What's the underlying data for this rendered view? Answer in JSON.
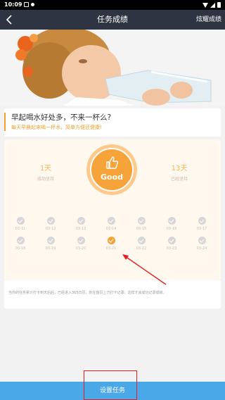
{
  "status_bar": {
    "time": "10:09"
  },
  "nav": {
    "back_icon": "chevron-left-icon",
    "title": "任务成绩",
    "share": "炫耀成绩"
  },
  "task": {
    "title": "早起喝水好处多，不来一杯么?",
    "subtitle": "每天早晨起来喝一杯水，简单方便还健康!"
  },
  "progress": {
    "completed_days": "1天",
    "completed_label": "成功坚持",
    "participants": "13天",
    "participants_label": "已经坚持",
    "badge": "Good",
    "days": [
      {
        "date": "03-11",
        "done": false
      },
      {
        "date": "03-12",
        "done": false
      },
      {
        "date": "03-13",
        "done": false
      },
      {
        "date": "03-14",
        "done": false
      },
      {
        "date": "03-15",
        "done": false
      },
      {
        "date": "03-16",
        "done": false
      },
      {
        "date": "03-17",
        "done": false
      },
      {
        "date": "03-18",
        "done": false
      },
      {
        "date": "03-19",
        "done": false
      },
      {
        "date": "03-20",
        "done": false
      },
      {
        "date": "03-21",
        "done": true
      },
      {
        "date": "03-22",
        "done": false
      },
      {
        "date": "03-23",
        "done": false
      },
      {
        "date": "03-24",
        "done": false
      }
    ]
  },
  "info": {
    "text": "当你的任务累计打卡到天后后，已经进入365日历，你在首页上方打卡记录。这样才会成功记录成绩。"
  },
  "footer": {
    "button": "设置任务"
  },
  "colors": {
    "accent": "#f6a43a",
    "nav_bg": "#2e3442",
    "button_bg": "#4aa8e8",
    "annotation": "#e02020"
  }
}
